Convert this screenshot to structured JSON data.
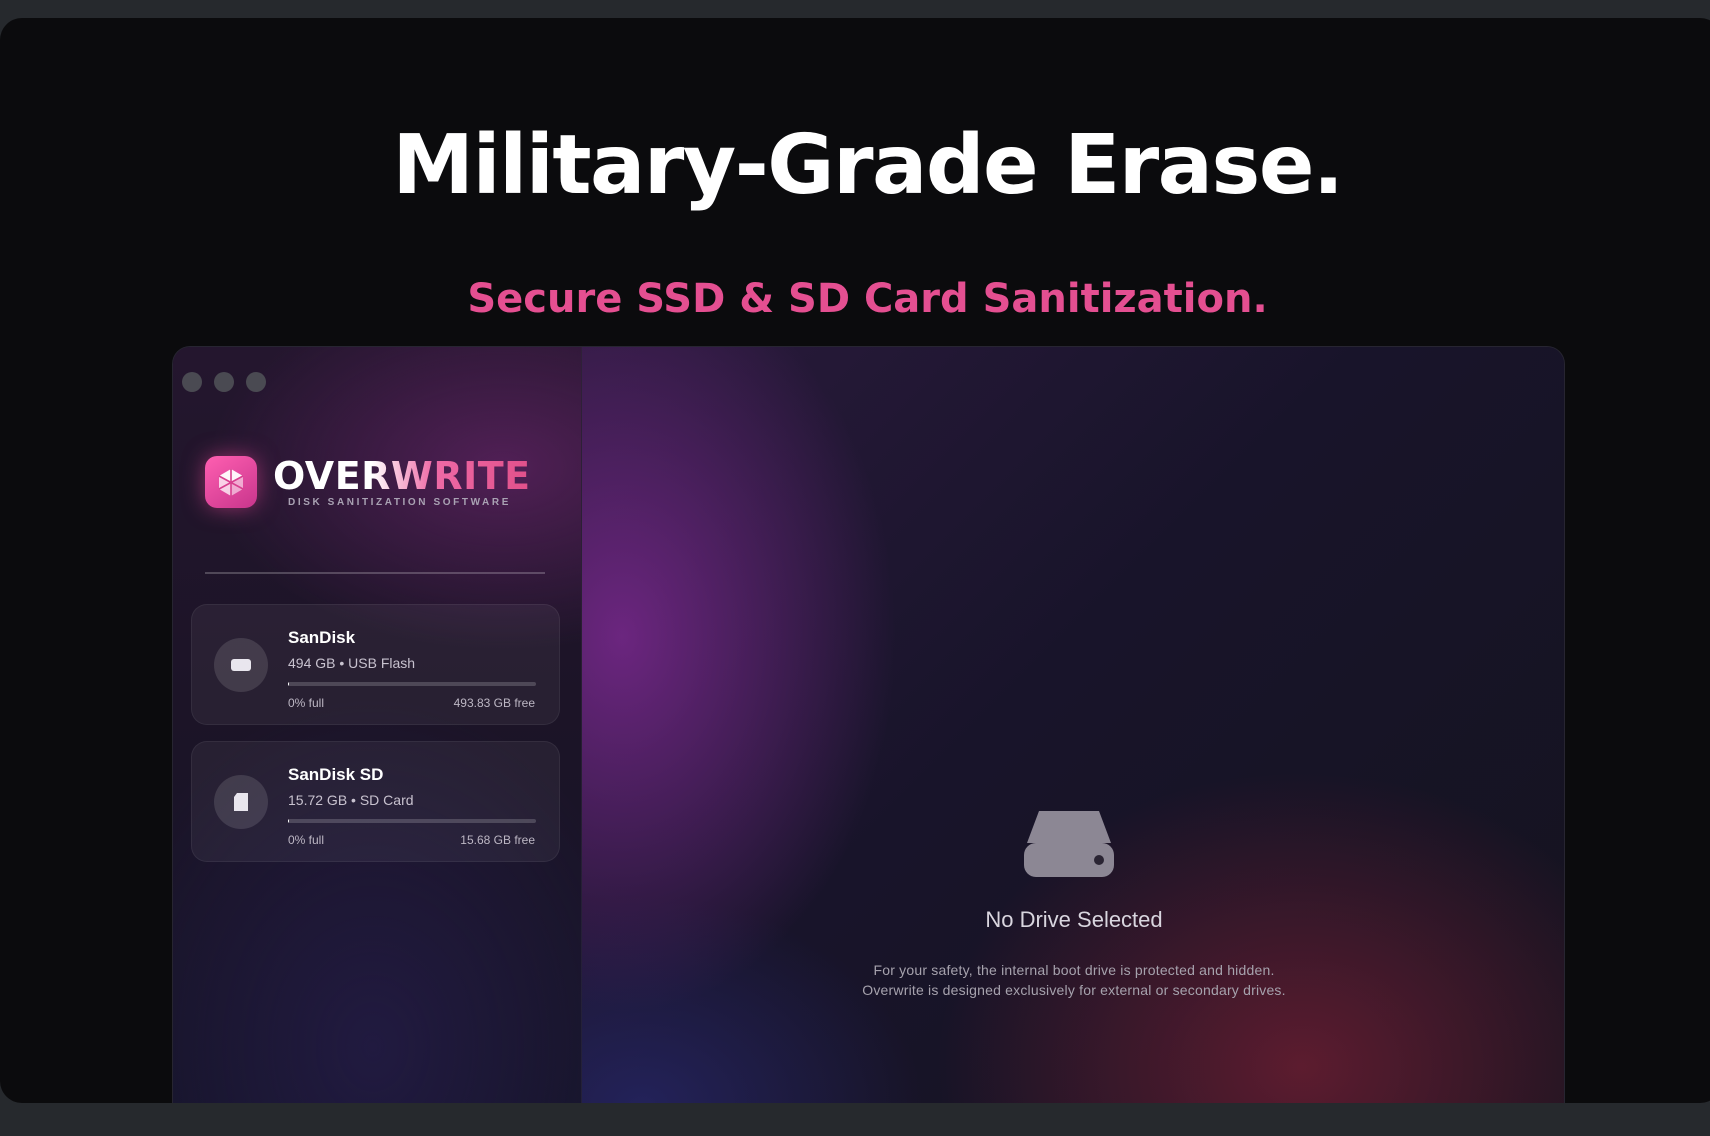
{
  "hero": {
    "title": "Military-Grade Erase.",
    "subtitle": "Secure SSD & SD Card Sanitization."
  },
  "app": {
    "brand": {
      "name": "OVERWRITE",
      "tagline": "DISK SANITIZATION SOFTWARE",
      "logo_icon": "cube-icon"
    },
    "drives": [
      {
        "name": "SanDisk",
        "meta": "494 GB • USB Flash",
        "usage_fraction": 0.0,
        "full_label": "0% full",
        "free_label": "493.83 GB free",
        "icon": "usb-drive-icon"
      },
      {
        "name": "SanDisk SD",
        "meta": "15.72 GB • SD Card",
        "usage_fraction": 0.005,
        "full_label": "0% full",
        "free_label": "15.68 GB free",
        "icon": "sd-card-icon"
      }
    ],
    "empty_state": {
      "icon": "hard-drive-icon",
      "title": "No Drive Selected",
      "line1": "For your safety, the internal boot drive is protected and hidden.",
      "line2": "Overwrite is designed exclusively for external or secondary drives."
    }
  },
  "colors": {
    "accent_pink": "#e44f91",
    "background": "#0b0b0d"
  }
}
